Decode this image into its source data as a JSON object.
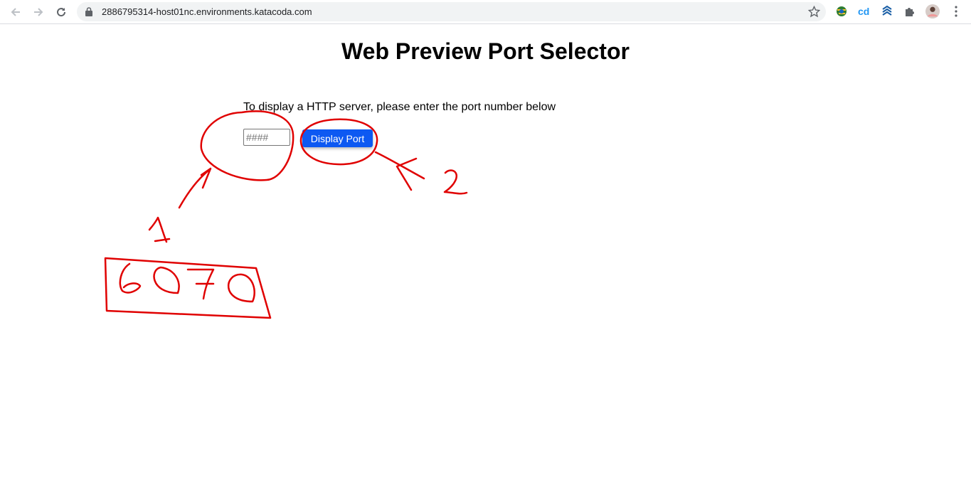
{
  "browser": {
    "url": "2886795314-host01nc.environments.katacoda.com",
    "back_icon": "arrow-left",
    "forward_icon": "arrow-right",
    "reload_icon": "reload",
    "lock_icon": "lock",
    "bookmark_icon": "star",
    "extensions": [
      "globe-extension",
      "cd-extension",
      "layers-extension",
      "puzzle-extension"
    ],
    "profile_icon": "avatar",
    "menu_icon": "kebab-menu"
  },
  "page": {
    "title": "Web Preview Port Selector",
    "intro": "To display a HTTP server, please enter the port number below",
    "port_placeholder": "####",
    "button_label": "Display Port",
    "accent": "#0d59f2"
  },
  "annotations": {
    "color": "#e00000",
    "step1": "1",
    "step2": "2",
    "port_written": "6070"
  }
}
